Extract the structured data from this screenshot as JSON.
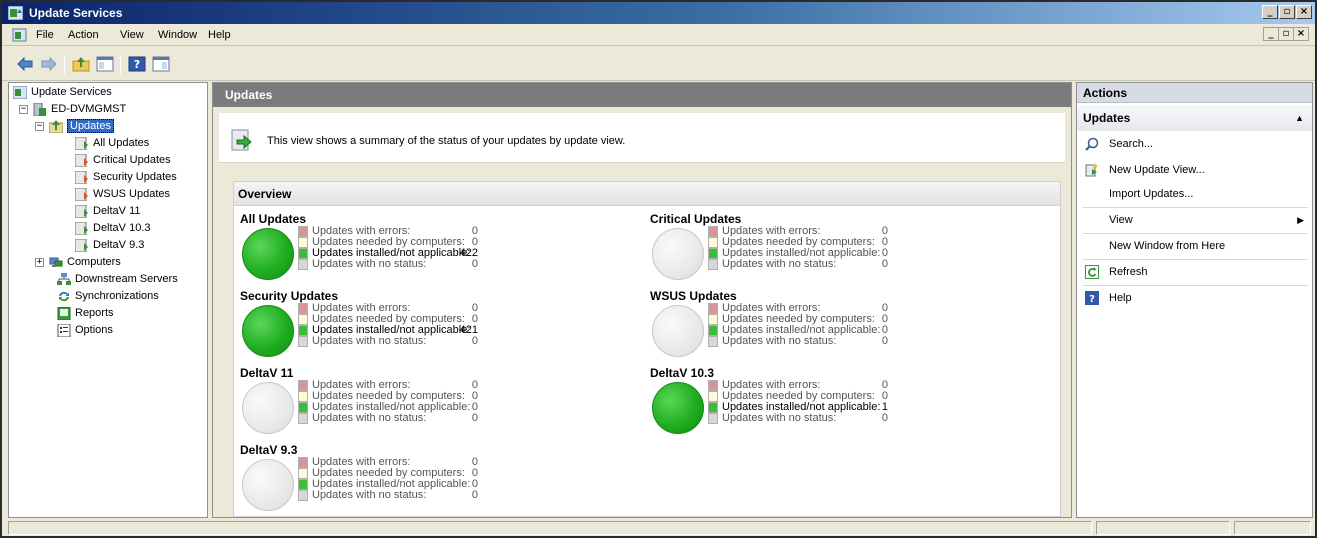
{
  "window": {
    "title": "Update Services"
  },
  "window_controls": {
    "minimize": "_",
    "restore": "▫",
    "close": "×"
  },
  "menu": {
    "items": [
      "File",
      "Action",
      "View",
      "Window",
      "Help"
    ]
  },
  "toolbar": {
    "icons": [
      "back-arrow-icon",
      "forward-arrow-icon",
      "up-folder-icon",
      "show-hide-tree-icon",
      "help-icon",
      "show-hide-action-pane-icon"
    ]
  },
  "tree": {
    "root": "Update Services",
    "server": "ED-DVMGMST",
    "updates": "Updates",
    "update_views": [
      "All Updates",
      "Critical Updates",
      "Security Updates",
      "WSUS Updates",
      "DeltaV 11",
      "DeltaV 10.3",
      "DeltaV 9.3"
    ],
    "computers": "Computers",
    "downstream": "Downstream Servers",
    "synchronizations": "Synchronizations",
    "reports": "Reports",
    "options": "Options",
    "expand_minus": "−",
    "expand_plus": "+"
  },
  "center": {
    "header": "Updates",
    "info_text": "This view shows a summary of the status of your updates by update view.",
    "overview_title": "Overview",
    "status_labels": [
      "Updates with errors:",
      "Updates needed by computers:",
      "Updates installed/not applicable:",
      "Updates with no status:"
    ],
    "status_colors": [
      "#d9949b",
      "#fffbd5",
      "#3cbd3c",
      "#d8d8d8"
    ],
    "groups": [
      {
        "title": "All Updates",
        "values": [
          "0",
          "0",
          "422",
          "0"
        ],
        "state": "green"
      },
      {
        "title": "Critical Updates",
        "values": [
          "0",
          "0",
          "0",
          "0"
        ],
        "state": "gray"
      },
      {
        "title": "Security Updates",
        "values": [
          "0",
          "0",
          "421",
          "0"
        ],
        "state": "green"
      },
      {
        "title": "WSUS Updates",
        "values": [
          "0",
          "0",
          "0",
          "0"
        ],
        "state": "gray"
      },
      {
        "title": "DeltaV 11",
        "values": [
          "0",
          "0",
          "0",
          "0"
        ],
        "state": "gray"
      },
      {
        "title": "DeltaV 10.3",
        "values": [
          "0",
          "0",
          "1",
          "0"
        ],
        "state": "green"
      },
      {
        "title": "DeltaV 9.3",
        "values": [
          "0",
          "0",
          "0",
          "0"
        ],
        "state": "gray"
      }
    ]
  },
  "actions": {
    "header": "Actions",
    "section": "Updates",
    "collapse_glyph": "▲",
    "submenu_glyph": "▶",
    "items": [
      "Search...",
      "New Update View...",
      "Import Updates...",
      "View",
      "New Window from Here",
      "Refresh",
      "Help"
    ]
  }
}
